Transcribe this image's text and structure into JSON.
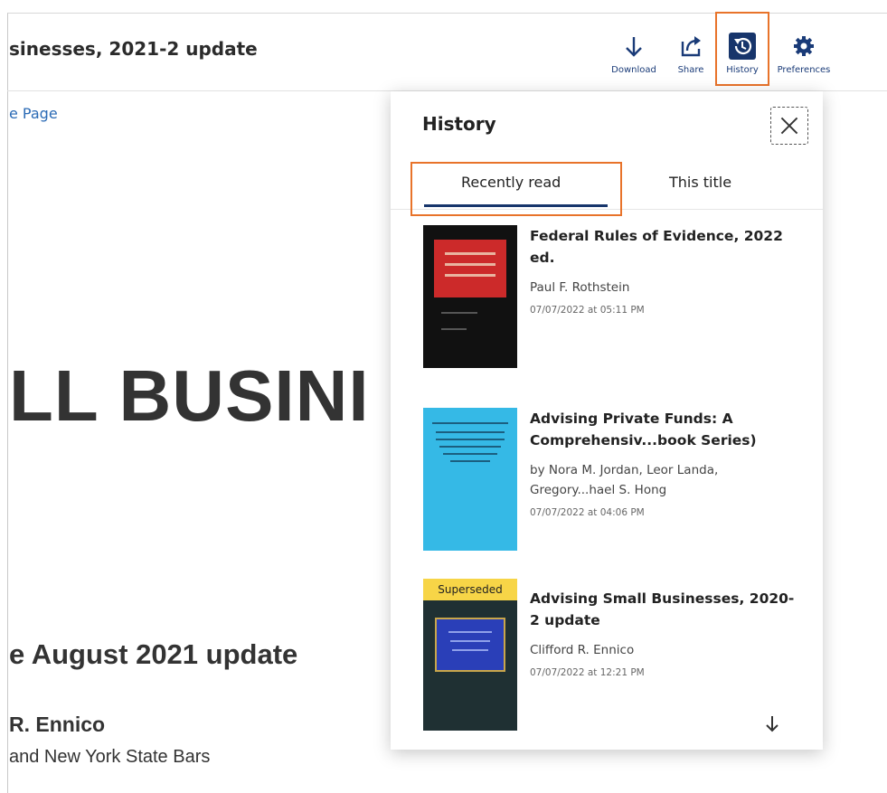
{
  "header": {
    "doc_title": "sinesses, 2021-2 update",
    "tools": [
      {
        "label": "Download",
        "icon": "download-icon"
      },
      {
        "label": "Share",
        "icon": "share-icon"
      },
      {
        "label": "History",
        "icon": "history-icon"
      },
      {
        "label": "Preferences",
        "icon": "gear-icon"
      }
    ]
  },
  "document": {
    "breadcrumb": "e Page",
    "big_title": "LL BUSINI",
    "subtitle": "e August 2021 update",
    "author": "R. Ennico",
    "bars": "and New York State Bars"
  },
  "history_panel": {
    "title": "History",
    "close_icon": "close-icon",
    "tabs": [
      {
        "label": "Recently read",
        "active": true
      },
      {
        "label": "This title",
        "active": false
      }
    ],
    "items": [
      {
        "title": "Federal Rules of Evidence, 2022 ed.",
        "author": "Paul F. Rothstein",
        "date": "07/07/2022 at 05:11 PM",
        "cover_color": "#111111",
        "cover_accent": "#cc2a2a"
      },
      {
        "title": "Advising Private Funds: A Comprehensiv...book Series)",
        "author": "by Nora M. Jordan, Leor Landa, Gregory...hael S. Hong",
        "date": "07/07/2022 at 04:06 PM",
        "cover_color": "#35b9e6"
      },
      {
        "title": "Advising Small Businesses, 2020-2 update",
        "author": "Clifford R. Ennico",
        "date": "07/07/2022 at 12:21 PM",
        "badge": "Superseded",
        "cover_color": "#1f3033",
        "cover_accent": "#2a3fb8"
      }
    ],
    "scroll_icon": "arrow-down-icon"
  },
  "colors": {
    "accent": "#17356b",
    "highlight": "#e8732a",
    "badge": "#f7d547"
  }
}
